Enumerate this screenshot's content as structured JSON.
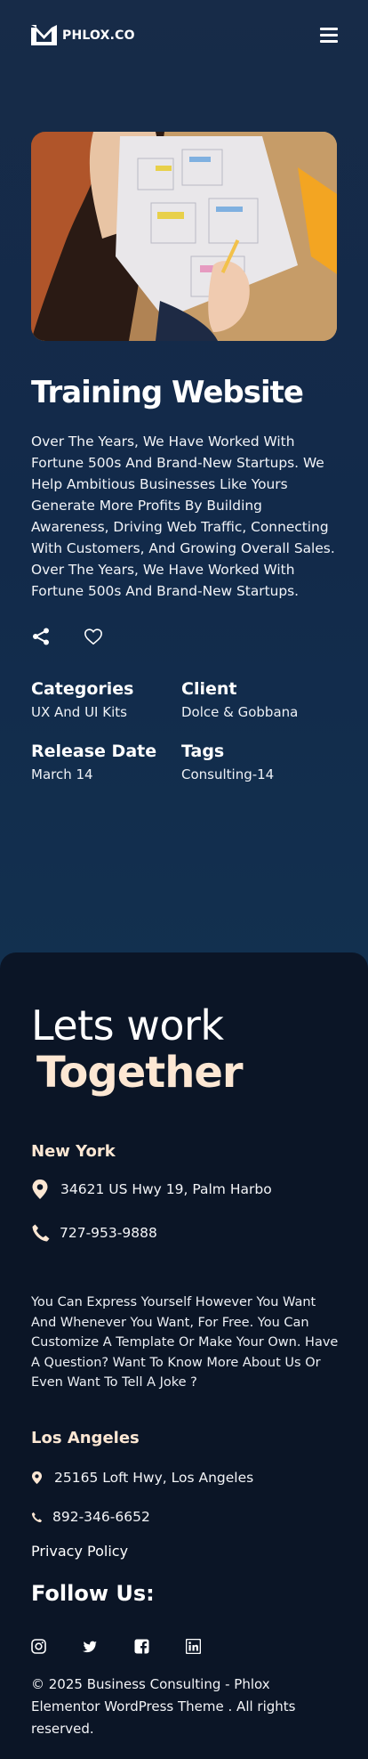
{
  "header": {
    "logo_text": "PHLOX.CO",
    "logo_icon": "phlox-logo-icon",
    "menu_icon": "hamburger-menu-icon"
  },
  "project": {
    "title": "Training Website",
    "description": "Over The Years, We Have Worked With Fortune 500s And Brand-New Startups. We Help Ambitious Businesses Like Yours Generate More Profits By Building Awareness, Driving Web Traffic, Connecting With Customers, And Growing Overall Sales. Over The Years, We Have Worked With Fortune 500s And Brand-New Startups.",
    "share_icon": "share-icon",
    "like_icon": "heart-icon",
    "meta": {
      "categories_label": "Categories",
      "categories_value": "UX And UI Kits",
      "client_label": "Client",
      "client_value": "Dolce & Gobbana",
      "release_label": "Release Date",
      "release_value": "March 14",
      "tags_label": "Tags",
      "tags_value": "Consulting-14"
    }
  },
  "footer": {
    "heading_line1": "Lets work",
    "heading_line2": "Together",
    "office1": {
      "city": "New York",
      "address": "34621 US Hwy 19, Palm Harbo",
      "phone": "727-953-9888"
    },
    "blurb": "You Can Express Yourself However You Want And Whenever You Want, For Free. You Can Customize A Template Or Make Your Own. Have A Question? Want To Know More About Us Or Even Want To Tell A Joke ?",
    "office2": {
      "city": "Los Angeles",
      "address": "25165 Loft Hwy, Los Angeles",
      "phone": "892-346-6652"
    },
    "privacy_label": "Privacy Policy",
    "follow_label": "Follow Us:",
    "socials": [
      "instagram-icon",
      "twitter-icon",
      "facebook-icon",
      "linkedin-icon"
    ],
    "copyright": "© 2025 Business Consulting - Phlox Elementor WordPress Theme . All rights reserved."
  },
  "colors": {
    "background_top": "#172b48",
    "background_footer": "#0b1526",
    "accent_cream": "#fde7d3",
    "text": "#ffffff"
  }
}
